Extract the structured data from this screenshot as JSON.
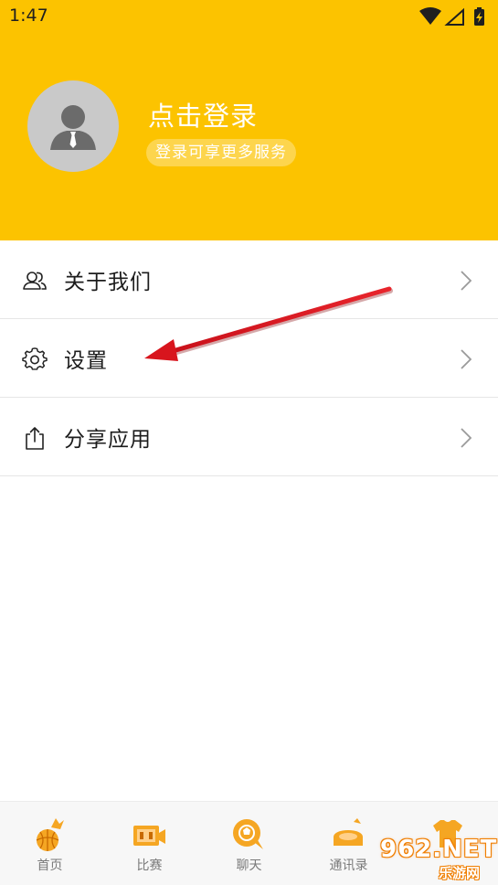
{
  "status_bar": {
    "time": "1:47",
    "icons": [
      "wifi-icon",
      "signal-icon",
      "battery-charging-icon"
    ]
  },
  "profile": {
    "avatar_icon": "user-avatar-icon",
    "login_title": "点击登录",
    "login_subtitle": "登录可享更多服务"
  },
  "menu": {
    "items": [
      {
        "label": "关于我们",
        "icon": "people-icon"
      },
      {
        "label": "设置",
        "icon": "gear-icon"
      },
      {
        "label": "分享应用",
        "icon": "share-icon"
      }
    ]
  },
  "tabbar": {
    "tabs": [
      {
        "label": "首页",
        "icon": "home-basketball-icon"
      },
      {
        "label": "比赛",
        "icon": "match-scoreboard-icon"
      },
      {
        "label": "聊天",
        "icon": "chat-bubble-icon"
      },
      {
        "label": "通讯录",
        "icon": "contacts-stadium-icon"
      },
      {
        "label": "",
        "icon": "jersey-icon"
      }
    ]
  },
  "watermark": {
    "big": "962.NET",
    "small": "乐游网"
  },
  "colors": {
    "header_bg": "#fcc300",
    "annotation_arrow": "#e0141b",
    "tab_icon_orange": "#f5a623"
  }
}
